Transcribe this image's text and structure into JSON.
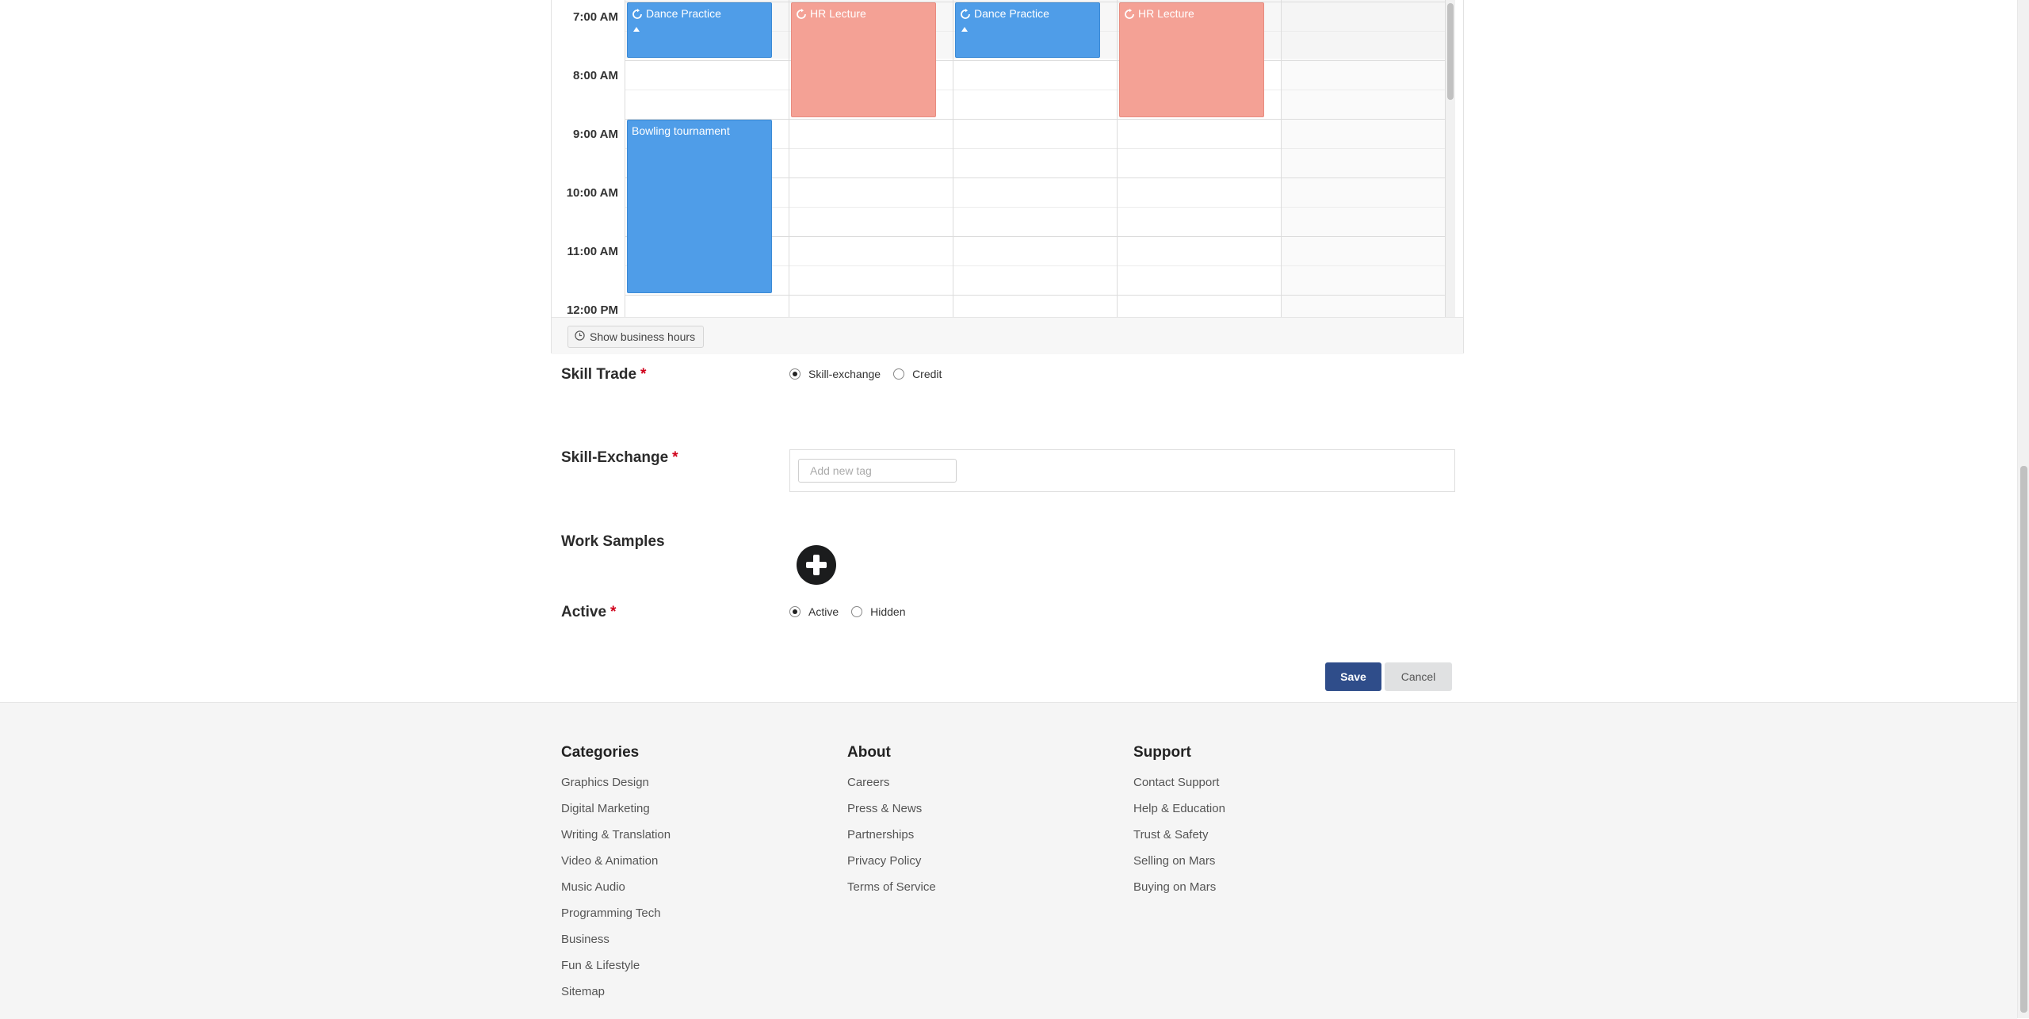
{
  "calendar": {
    "time_labels": [
      "7:00 AM",
      "8:00 AM",
      "9:00 AM",
      "10:00 AM",
      "11:00 AM",
      "12:00 PM"
    ],
    "events": [
      {
        "title": "Dance Practice",
        "color": "#4f9de8",
        "recurring": true
      },
      {
        "title": "HR Lecture",
        "color": "#f4a195",
        "recurring": true
      },
      {
        "title": "Dance Practice",
        "color": "#4f9de8",
        "recurring": true
      },
      {
        "title": "HR Lecture",
        "color": "#f4a195",
        "recurring": true
      },
      {
        "title": "Bowling tournament",
        "color": "#4f9de8",
        "recurring": false
      }
    ],
    "business_hours_button": "Show business hours",
    "business_hours_icon": "clock-icon"
  },
  "form": {
    "skill_trade": {
      "label": "Skill Trade",
      "required_mark": "*",
      "options": [
        "Skill-exchange",
        "Credit"
      ],
      "selected": "Skill-exchange"
    },
    "skill_exchange": {
      "label": "Skill-Exchange",
      "required_mark": "*",
      "placeholder": "Add new tag"
    },
    "work_samples": {
      "label": "Work Samples",
      "add_icon": "plus-circle-icon"
    },
    "active": {
      "label": "Active",
      "required_mark": "*",
      "options": [
        "Active",
        "Hidden"
      ],
      "selected": "Active"
    },
    "save_label": "Save",
    "cancel_label": "Cancel"
  },
  "footer": {
    "categories": {
      "title": "Categories",
      "links": [
        "Graphics Design",
        "Digital Marketing",
        "Writing & Translation",
        "Video & Animation",
        "Music Audio",
        "Programming Tech",
        "Business",
        "Fun & Lifestyle",
        "Sitemap"
      ]
    },
    "about": {
      "title": "About",
      "links": [
        "Careers",
        "Press & News",
        "Partnerships",
        "Privacy Policy",
        "Terms of Service"
      ]
    },
    "support": {
      "title": "Support",
      "links": [
        "Contact Support",
        "Help & Education",
        "Trust & Safety",
        "Selling on Mars",
        "Buying on Mars"
      ]
    }
  }
}
